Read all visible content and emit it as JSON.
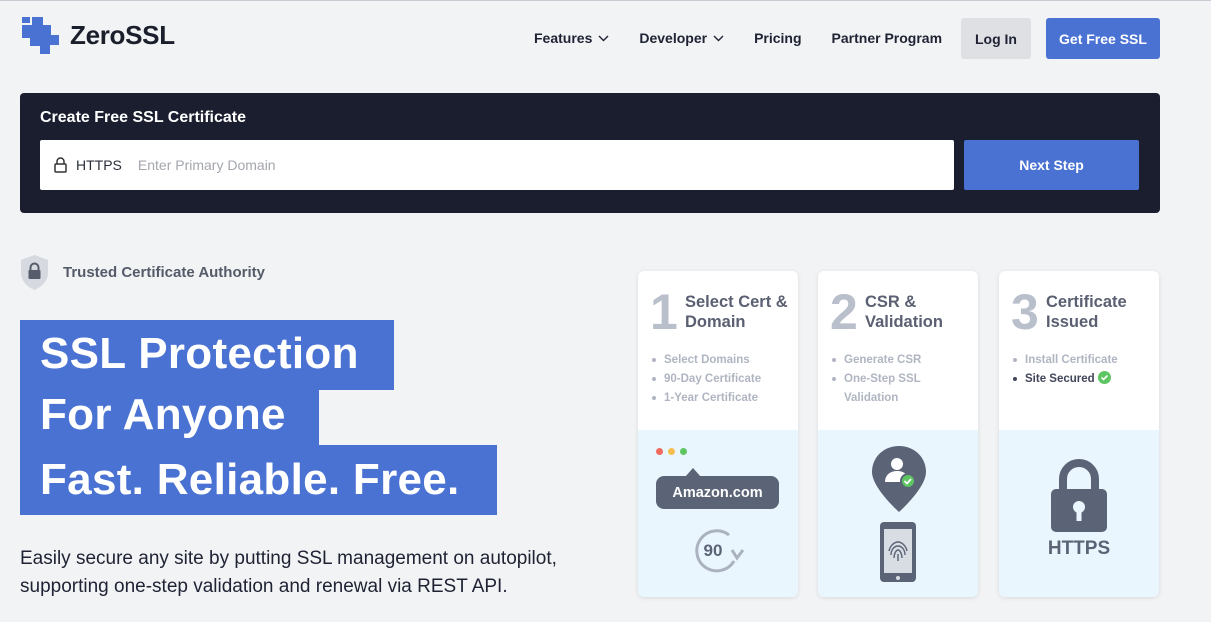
{
  "brand": {
    "name": "ZeroSSL",
    "accent": "#4a72d3",
    "dark": "#1b1e2e"
  },
  "nav": {
    "items": [
      {
        "label": "Features",
        "dropdown": true
      },
      {
        "label": "Developer",
        "dropdown": true
      },
      {
        "label": "Pricing",
        "dropdown": false
      },
      {
        "label": "Partner Program",
        "dropdown": false
      }
    ],
    "login_label": "Log In",
    "cta_label": "Get Free SSL"
  },
  "create": {
    "title": "Create Free SSL Certificate",
    "protocol": "HTTPS",
    "placeholder": "Enter Primary Domain",
    "value": "",
    "next_label": "Next Step"
  },
  "hero": {
    "badge_text": "Trusted Certificate Authority",
    "lines": [
      "SSL Protection",
      "For Anyone",
      "Fast. Reliable. Free."
    ],
    "description": "Easily secure any site by putting SSL management on autopilot, supporting one-step validation and renewal via REST API."
  },
  "steps": [
    {
      "number": "1",
      "title": "Select Cert & Domain",
      "items": [
        {
          "text": "Select Domains",
          "done": false
        },
        {
          "text": "90-Day Certificate",
          "done": false
        },
        {
          "text": "1-Year Certificate",
          "done": false
        }
      ],
      "illustration": {
        "domain": "Amazon.com",
        "days": "90"
      }
    },
    {
      "number": "2",
      "title": "CSR & Validation",
      "items": [
        {
          "text": "Generate CSR",
          "done": false
        },
        {
          "text": "One-Step SSL Validation",
          "done": false
        }
      ],
      "illustration": {
        "icons": [
          "user-pin-icon",
          "fingerprint-phone-icon"
        ]
      }
    },
    {
      "number": "3",
      "title": "Certificate Issued",
      "items": [
        {
          "text": "Install Certificate",
          "done": false
        },
        {
          "text": "Site Secured",
          "done": true
        }
      ],
      "illustration": {
        "label": "HTTPS"
      }
    }
  ]
}
